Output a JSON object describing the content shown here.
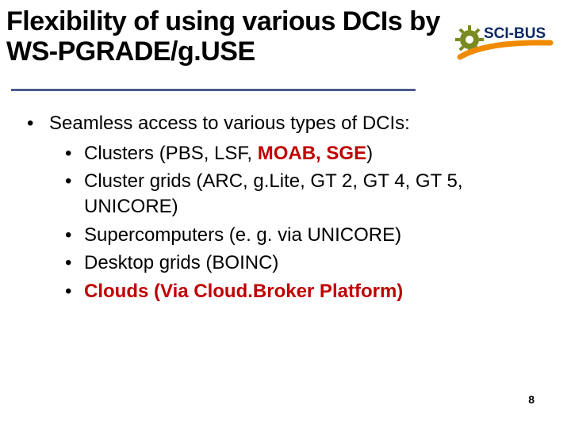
{
  "title": "Flexibility of using various DCIs by WS-PGRADE/g.USE",
  "logo": {
    "name": "SCI-BUS",
    "colors": {
      "dark": "#0a2a66",
      "orange": "#f08a00",
      "gear": "#7a8a22"
    }
  },
  "main": {
    "heading": "Seamless access to various types of DCIs:",
    "items": [
      {
        "pre": "Clusters (PBS, LSF, ",
        "highlight": "MOAB, SGE",
        "post": ")"
      },
      {
        "pre": "Cluster grids (ARC, g.Lite, GT 2, GT 4, GT 5, UNICORE)",
        "highlight": "",
        "post": ""
      },
      {
        "pre": "Supercomputers (e. g. via UNICORE)",
        "highlight": "",
        "post": ""
      },
      {
        "pre": "Desktop grids (BOINC)",
        "highlight": "",
        "post": ""
      },
      {
        "pre": "",
        "highlight": "Clouds (Via Cloud.Broker Platform)",
        "post": ""
      }
    ]
  },
  "page_number": "8"
}
